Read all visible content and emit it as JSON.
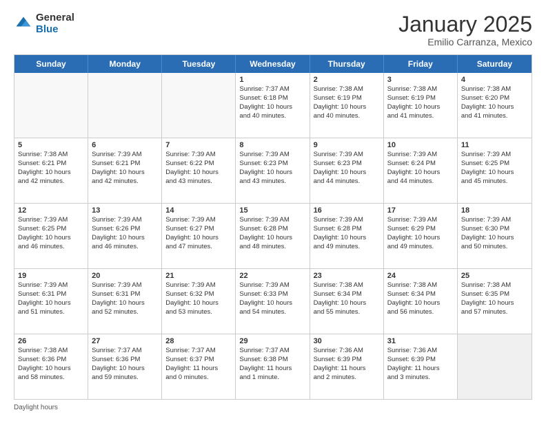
{
  "logo": {
    "text_general": "General",
    "text_blue": "Blue"
  },
  "title": "January 2025",
  "subtitle": "Emilio Carranza, Mexico",
  "days_of_week": [
    "Sunday",
    "Monday",
    "Tuesday",
    "Wednesday",
    "Thursday",
    "Friday",
    "Saturday"
  ],
  "footer": "Daylight hours",
  "weeks": [
    [
      {
        "day": "",
        "empty": true
      },
      {
        "day": "",
        "empty": true
      },
      {
        "day": "",
        "empty": true
      },
      {
        "day": "1",
        "lines": [
          "Sunrise: 7:37 AM",
          "Sunset: 6:18 PM",
          "Daylight: 10 hours",
          "and 40 minutes."
        ]
      },
      {
        "day": "2",
        "lines": [
          "Sunrise: 7:38 AM",
          "Sunset: 6:19 PM",
          "Daylight: 10 hours",
          "and 40 minutes."
        ]
      },
      {
        "day": "3",
        "lines": [
          "Sunrise: 7:38 AM",
          "Sunset: 6:19 PM",
          "Daylight: 10 hours",
          "and 41 minutes."
        ]
      },
      {
        "day": "4",
        "lines": [
          "Sunrise: 7:38 AM",
          "Sunset: 6:20 PM",
          "Daylight: 10 hours",
          "and 41 minutes."
        ]
      }
    ],
    [
      {
        "day": "5",
        "lines": [
          "Sunrise: 7:38 AM",
          "Sunset: 6:21 PM",
          "Daylight: 10 hours",
          "and 42 minutes."
        ]
      },
      {
        "day": "6",
        "lines": [
          "Sunrise: 7:39 AM",
          "Sunset: 6:21 PM",
          "Daylight: 10 hours",
          "and 42 minutes."
        ]
      },
      {
        "day": "7",
        "lines": [
          "Sunrise: 7:39 AM",
          "Sunset: 6:22 PM",
          "Daylight: 10 hours",
          "and 43 minutes."
        ]
      },
      {
        "day": "8",
        "lines": [
          "Sunrise: 7:39 AM",
          "Sunset: 6:23 PM",
          "Daylight: 10 hours",
          "and 43 minutes."
        ]
      },
      {
        "day": "9",
        "lines": [
          "Sunrise: 7:39 AM",
          "Sunset: 6:23 PM",
          "Daylight: 10 hours",
          "and 44 minutes."
        ]
      },
      {
        "day": "10",
        "lines": [
          "Sunrise: 7:39 AM",
          "Sunset: 6:24 PM",
          "Daylight: 10 hours",
          "and 44 minutes."
        ]
      },
      {
        "day": "11",
        "lines": [
          "Sunrise: 7:39 AM",
          "Sunset: 6:25 PM",
          "Daylight: 10 hours",
          "and 45 minutes."
        ]
      }
    ],
    [
      {
        "day": "12",
        "lines": [
          "Sunrise: 7:39 AM",
          "Sunset: 6:25 PM",
          "Daylight: 10 hours",
          "and 46 minutes."
        ]
      },
      {
        "day": "13",
        "lines": [
          "Sunrise: 7:39 AM",
          "Sunset: 6:26 PM",
          "Daylight: 10 hours",
          "and 46 minutes."
        ]
      },
      {
        "day": "14",
        "lines": [
          "Sunrise: 7:39 AM",
          "Sunset: 6:27 PM",
          "Daylight: 10 hours",
          "and 47 minutes."
        ]
      },
      {
        "day": "15",
        "lines": [
          "Sunrise: 7:39 AM",
          "Sunset: 6:28 PM",
          "Daylight: 10 hours",
          "and 48 minutes."
        ]
      },
      {
        "day": "16",
        "lines": [
          "Sunrise: 7:39 AM",
          "Sunset: 6:28 PM",
          "Daylight: 10 hours",
          "and 49 minutes."
        ]
      },
      {
        "day": "17",
        "lines": [
          "Sunrise: 7:39 AM",
          "Sunset: 6:29 PM",
          "Daylight: 10 hours",
          "and 49 minutes."
        ]
      },
      {
        "day": "18",
        "lines": [
          "Sunrise: 7:39 AM",
          "Sunset: 6:30 PM",
          "Daylight: 10 hours",
          "and 50 minutes."
        ]
      }
    ],
    [
      {
        "day": "19",
        "lines": [
          "Sunrise: 7:39 AM",
          "Sunset: 6:31 PM",
          "Daylight: 10 hours",
          "and 51 minutes."
        ]
      },
      {
        "day": "20",
        "lines": [
          "Sunrise: 7:39 AM",
          "Sunset: 6:31 PM",
          "Daylight: 10 hours",
          "and 52 minutes."
        ]
      },
      {
        "day": "21",
        "lines": [
          "Sunrise: 7:39 AM",
          "Sunset: 6:32 PM",
          "Daylight: 10 hours",
          "and 53 minutes."
        ]
      },
      {
        "day": "22",
        "lines": [
          "Sunrise: 7:39 AM",
          "Sunset: 6:33 PM",
          "Daylight: 10 hours",
          "and 54 minutes."
        ]
      },
      {
        "day": "23",
        "lines": [
          "Sunrise: 7:38 AM",
          "Sunset: 6:34 PM",
          "Daylight: 10 hours",
          "and 55 minutes."
        ]
      },
      {
        "day": "24",
        "lines": [
          "Sunrise: 7:38 AM",
          "Sunset: 6:34 PM",
          "Daylight: 10 hours",
          "and 56 minutes."
        ]
      },
      {
        "day": "25",
        "lines": [
          "Sunrise: 7:38 AM",
          "Sunset: 6:35 PM",
          "Daylight: 10 hours",
          "and 57 minutes."
        ]
      }
    ],
    [
      {
        "day": "26",
        "lines": [
          "Sunrise: 7:38 AM",
          "Sunset: 6:36 PM",
          "Daylight: 10 hours",
          "and 58 minutes."
        ]
      },
      {
        "day": "27",
        "lines": [
          "Sunrise: 7:37 AM",
          "Sunset: 6:36 PM",
          "Daylight: 10 hours",
          "and 59 minutes."
        ]
      },
      {
        "day": "28",
        "lines": [
          "Sunrise: 7:37 AM",
          "Sunset: 6:37 PM",
          "Daylight: 11 hours",
          "and 0 minutes."
        ]
      },
      {
        "day": "29",
        "lines": [
          "Sunrise: 7:37 AM",
          "Sunset: 6:38 PM",
          "Daylight: 11 hours",
          "and 1 minute."
        ]
      },
      {
        "day": "30",
        "lines": [
          "Sunrise: 7:36 AM",
          "Sunset: 6:39 PM",
          "Daylight: 11 hours",
          "and 2 minutes."
        ]
      },
      {
        "day": "31",
        "lines": [
          "Sunrise: 7:36 AM",
          "Sunset: 6:39 PM",
          "Daylight: 11 hours",
          "and 3 minutes."
        ]
      },
      {
        "day": "",
        "empty": true,
        "shaded": true
      }
    ]
  ]
}
